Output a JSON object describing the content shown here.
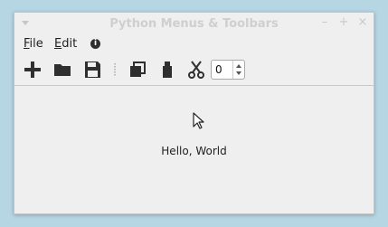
{
  "window": {
    "title": "Python Menus & Toolbars"
  },
  "menubar": {
    "items": [
      {
        "label_mnemonic": "F",
        "label_rest": "ile"
      },
      {
        "label_mnemonic": "E",
        "label_rest": "dit"
      }
    ],
    "info_icon": "info-icon"
  },
  "toolbar": {
    "buttons": [
      {
        "name": "new-icon"
      },
      {
        "name": "open-folder-icon"
      },
      {
        "name": "save-icon"
      },
      {
        "name": "copy-icon"
      },
      {
        "name": "paste-icon"
      },
      {
        "name": "cut-icon"
      }
    ],
    "spinbox_value": "0"
  },
  "central": {
    "text": "Hello, World"
  },
  "colors": {
    "desktop": "#b7d6e4",
    "window_bg": "#efefef",
    "icon_dark": "#2f2f2f"
  }
}
